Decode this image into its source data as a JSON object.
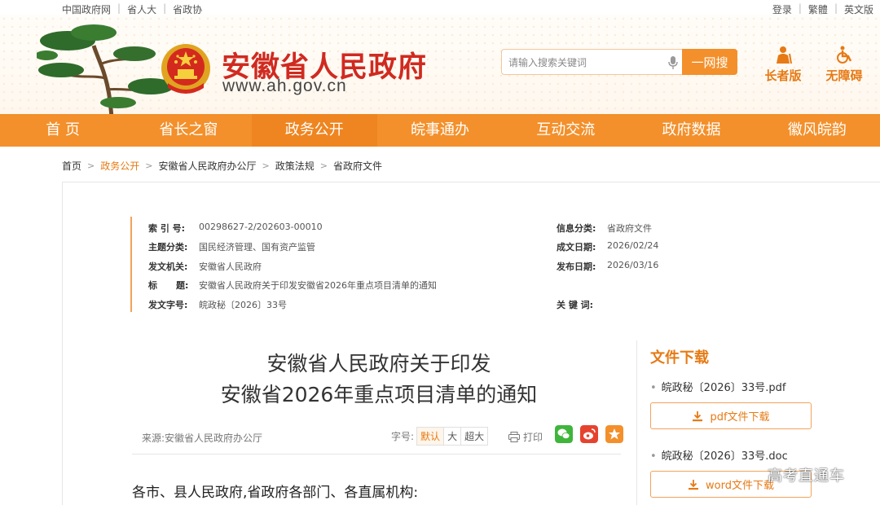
{
  "top_links": {
    "left": [
      "中国政府网",
      "省人大",
      "省政协"
    ],
    "right": [
      "登录",
      "繁體",
      "英文版"
    ]
  },
  "header": {
    "site_name": "安徽省人民政府",
    "site_url": "www.ah.gov.cn",
    "search_placeholder": "请输入搜索关键词",
    "search_button": "一网搜",
    "elder_label": "长者版",
    "accessible_label": "无障碍"
  },
  "nav": [
    "首 页",
    "省长之窗",
    "政务公开",
    "皖事通办",
    "互动交流",
    "政府数据",
    "徽风皖韵"
  ],
  "nav_active_index": 2,
  "breadcrumb": [
    "首页",
    "政务公开",
    "安徽省人民政府办公厅",
    "政策法规",
    "省政府文件"
  ],
  "meta": {
    "index_label": "索 引 号:",
    "index_value": "00298627-2/202603-00010",
    "topic_label": "主题分类:",
    "topic_value": "国民经济管理、国有资产监管",
    "issuer_label": "发文机关:",
    "issuer_value": "安徽省人民政府",
    "title_label": "标      题:",
    "title_value": "安徽省人民政府关于印发安徽省2026年重点项目清单的通知",
    "docno_label": "发文字号:",
    "docno_value": "皖政秘〔2026〕33号",
    "category_label": "信息分类:",
    "category_value": "省政府文件",
    "created_label": "成文日期:",
    "created_value": "2026/02/24",
    "published_label": "发布日期:",
    "published_value": "2026/03/16",
    "keywords_label": "关 键 词:",
    "keywords_value": ""
  },
  "article": {
    "title_line1": "安徽省人民政府关于印发",
    "title_line2": "安徽省2026年重点项目清单的通知",
    "source": "来源:安徽省人民政府办公厅",
    "font_size_label": "字号:",
    "font_sizes": [
      "默认",
      "大",
      "超大"
    ],
    "print_label": "打印",
    "greeting": "各市、县人民政府,省政府各部门、各直属机构:"
  },
  "downloads": {
    "title": "文件下载",
    "pdf_name": "皖政秘〔2026〕33号.pdf",
    "pdf_button": "pdf文件下载",
    "doc_name": "皖政秘〔2026〕33号.doc",
    "doc_button": "word文件下载"
  },
  "watermark": "高考直通车",
  "colors": {
    "accent": "#f3902b",
    "brand_red": "#d02a20",
    "link_orange": "#e67a14"
  }
}
